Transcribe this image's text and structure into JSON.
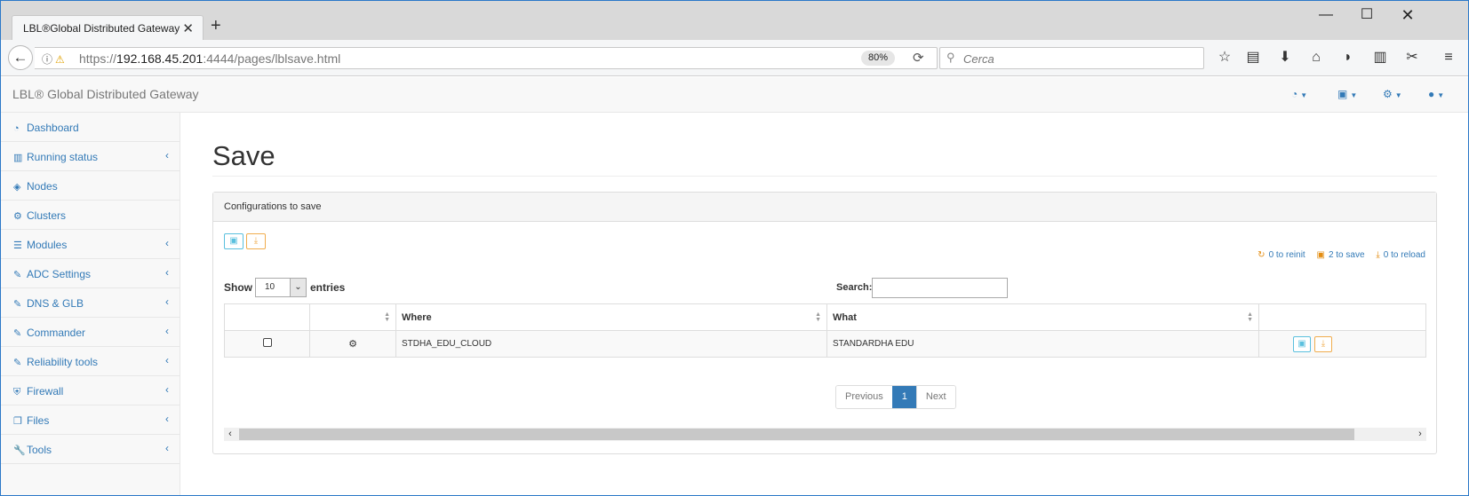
{
  "browser": {
    "tab_title": "LBL®Global Distributed Gateway",
    "tab_close": "✕",
    "new_tab": "+",
    "window_controls": {
      "minimize": "—",
      "maximize": "☐",
      "close": "✕"
    },
    "url_scheme": "https://",
    "url_host": "192.168.45.201",
    "url_rest": ":4444/pages/lblsave.html",
    "zoom": "80%",
    "search_placeholder": "Cerca",
    "icons": [
      "star-icon",
      "clipboard-icon",
      "download-icon",
      "home-icon",
      "pocket-icon",
      "library-icon",
      "screenshot-icon",
      "menu-icon"
    ]
  },
  "app": {
    "brand": "LBL® Global Distributed Gateway",
    "header_menus": [
      "dashboard-menu",
      "save-menu",
      "settings-menu",
      "user-menu"
    ]
  },
  "sidebar": {
    "items": [
      {
        "label": "Dashboard",
        "icon": "dashboard-icon",
        "glyph": "◔",
        "has_submenu": false
      },
      {
        "label": "Running status",
        "icon": "bar-chart-icon",
        "glyph": "▥",
        "has_submenu": true
      },
      {
        "label": "Nodes",
        "icon": "cube-icon",
        "glyph": "◈",
        "has_submenu": false
      },
      {
        "label": "Clusters",
        "icon": "cogs-icon",
        "glyph": "⚙",
        "has_submenu": false
      },
      {
        "label": "Modules",
        "icon": "list-icon",
        "glyph": "☰",
        "has_submenu": true
      },
      {
        "label": "ADC Settings",
        "icon": "edit-icon",
        "glyph": "✎",
        "has_submenu": true
      },
      {
        "label": "DNS & GLB",
        "icon": "edit-icon",
        "glyph": "✎",
        "has_submenu": true
      },
      {
        "label": "Commander",
        "icon": "edit-icon",
        "glyph": "✎",
        "has_submenu": true
      },
      {
        "label": "Reliability tools",
        "icon": "edit-icon",
        "glyph": "✎",
        "has_submenu": true
      },
      {
        "label": "Firewall",
        "icon": "shield-icon",
        "glyph": "⛨",
        "has_submenu": true
      },
      {
        "label": "Files",
        "icon": "files-icon",
        "glyph": "❐",
        "has_submenu": true
      },
      {
        "label": "Tools",
        "icon": "wrench-icon",
        "glyph": "🔧",
        "has_submenu": true
      }
    ],
    "submenu_arrow": "‹"
  },
  "main": {
    "title": "Save",
    "panel_heading": "Configurations to save",
    "counters": [
      {
        "icon": "refresh-icon",
        "glyph": "↻",
        "text": "0 to reinit"
      },
      {
        "icon": "save-icon",
        "glyph": "▣",
        "text": "2 to save"
      },
      {
        "icon": "download-icon",
        "glyph": "⤓",
        "text": "0 to reload"
      }
    ],
    "table_controls": {
      "show_label": "Show",
      "page_length": "10",
      "entries_label": "entries",
      "search_label": "Search:",
      "search_value": ""
    },
    "table": {
      "columns": [
        "",
        "",
        "Where",
        "What",
        ""
      ],
      "rows": [
        {
          "checked": false,
          "type_icon": "cogs-icon",
          "where": "STDHA_EDU_CLOUD",
          "what": "STANDARDHA EDU"
        }
      ]
    },
    "pagination": {
      "previous": "Previous",
      "current": "1",
      "next": "Next"
    },
    "colors": {
      "link": "#337ab7",
      "info": "#5bc0de",
      "warning": "#f0ad4e"
    }
  }
}
